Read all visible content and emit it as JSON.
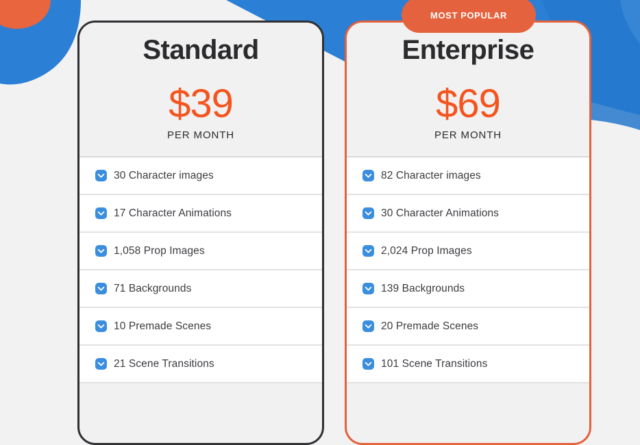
{
  "theme": {
    "orange": "#f4551e",
    "badge_orange": "#e4633e",
    "blue": "#2b7fd4",
    "check_blue": "#3b8ede",
    "dark_border": "#2f2f33",
    "card_head_bg": "#f1f1f1",
    "page_bg": "#f2f2f2"
  },
  "badge": {
    "label": "MOST POPULAR",
    "icon": "badge-pill"
  },
  "plans": [
    {
      "id": "standard",
      "name": "Standard",
      "price": "$39",
      "period": "PER MONTH",
      "border_color": "#2f2f33",
      "features": [
        {
          "icon": "check-circle-icon",
          "label": "30 Character images"
        },
        {
          "icon": "check-circle-icon",
          "label": "17 Character Animations"
        },
        {
          "icon": "check-circle-icon",
          "label": "1,058 Prop Images"
        },
        {
          "icon": "check-circle-icon",
          "label": "71 Backgrounds"
        },
        {
          "icon": "check-circle-icon",
          "label": "10 Premade Scenes"
        },
        {
          "icon": "check-circle-icon",
          "label": "21 Scene Transitions"
        }
      ]
    },
    {
      "id": "enterprise",
      "name": "Enterprise",
      "price": "$69",
      "period": "PER MONTH",
      "border_color": "#e2623c",
      "features": [
        {
          "icon": "check-circle-icon",
          "label": "82 Character images"
        },
        {
          "icon": "check-circle-icon",
          "label": "30 Character Animations"
        },
        {
          "icon": "check-circle-icon",
          "label": "2,024 Prop Images"
        },
        {
          "icon": "check-circle-icon",
          "label": "139 Backgrounds"
        },
        {
          "icon": "check-circle-icon",
          "label": "20 Premade Scenes"
        },
        {
          "icon": "check-circle-icon",
          "label": "101 Scene Transitions"
        }
      ]
    }
  ]
}
